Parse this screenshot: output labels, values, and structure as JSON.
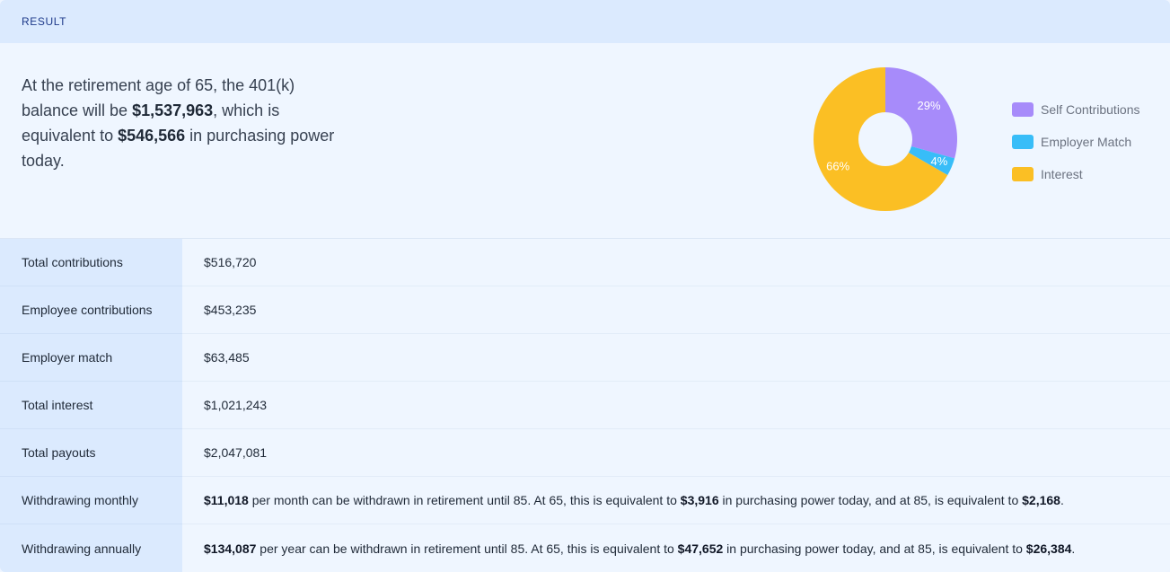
{
  "header": {
    "label": "RESULT"
  },
  "summary": {
    "p1": "At the retirement age of 65, the 401(k) balance will be ",
    "b1": "$1,537,963",
    "p2": ", which is equivalent to ",
    "b2": "$546,566",
    "p3": " in purchasing power today."
  },
  "chart_data": {
    "type": "pie",
    "style": "donut",
    "categories": [
      "Self Contributions",
      "Employer Match",
      "Interest"
    ],
    "values": [
      29,
      4,
      66
    ],
    "labels": [
      "29%",
      "4%",
      "66%"
    ],
    "colors": [
      "#a78bfa",
      "#38bdf8",
      "#fbbf24"
    ],
    "legend_position": "right"
  },
  "rows": [
    {
      "label": "Total contributions",
      "value": "$516,720"
    },
    {
      "label": "Employee contributions",
      "value": "$453,235"
    },
    {
      "label": "Employer match",
      "value": "$63,485"
    },
    {
      "label": "Total interest",
      "value": "$1,021,243"
    },
    {
      "label": "Total payouts",
      "value": "$2,047,081"
    }
  ],
  "withdraw_monthly": {
    "label": "Withdrawing monthly",
    "b1": "$11,018",
    "t1": " per month can be withdrawn in retirement until 85. At 65, this is equivalent to ",
    "b2": "$3,916",
    "t2": " in purchasing power today, and at 85, is equivalent to ",
    "b3": "$2,168",
    "t3": "."
  },
  "withdraw_annually": {
    "label": "Withdrawing annually",
    "b1": "$134,087",
    "t1": " per year can be withdrawn in retirement until 85. At 65, this is equivalent to ",
    "b2": "$47,652",
    "t2": " in purchasing power today, and at 85, is equivalent to ",
    "b3": "$26,384",
    "t3": "."
  }
}
